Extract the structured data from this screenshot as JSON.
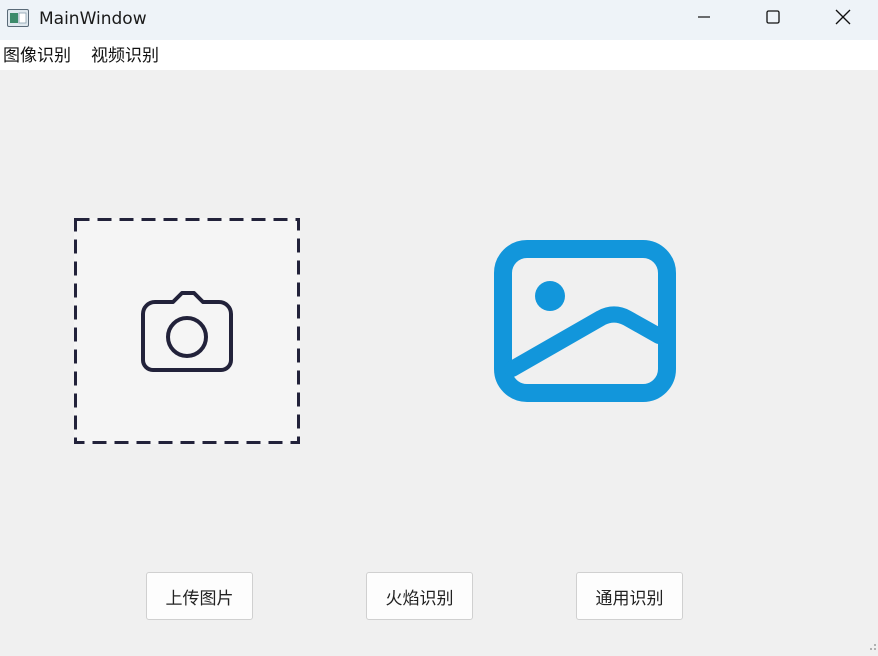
{
  "window": {
    "title": "MainWindow",
    "app_icon": "app-window-icon",
    "controls": {
      "minimize": "minimize-icon",
      "maximize": "maximize-icon",
      "close": "close-icon"
    }
  },
  "menubar": {
    "items": [
      "图像识别",
      "视频识别"
    ]
  },
  "upload_area": {
    "icon": "camera-icon",
    "border_color": "#22223a"
  },
  "preview": {
    "icon": "image-placeholder-icon",
    "color": "#1296db"
  },
  "actions": {
    "upload_label": "上传图片",
    "fire_label": "火焰识别",
    "general_label": "通用识别"
  }
}
